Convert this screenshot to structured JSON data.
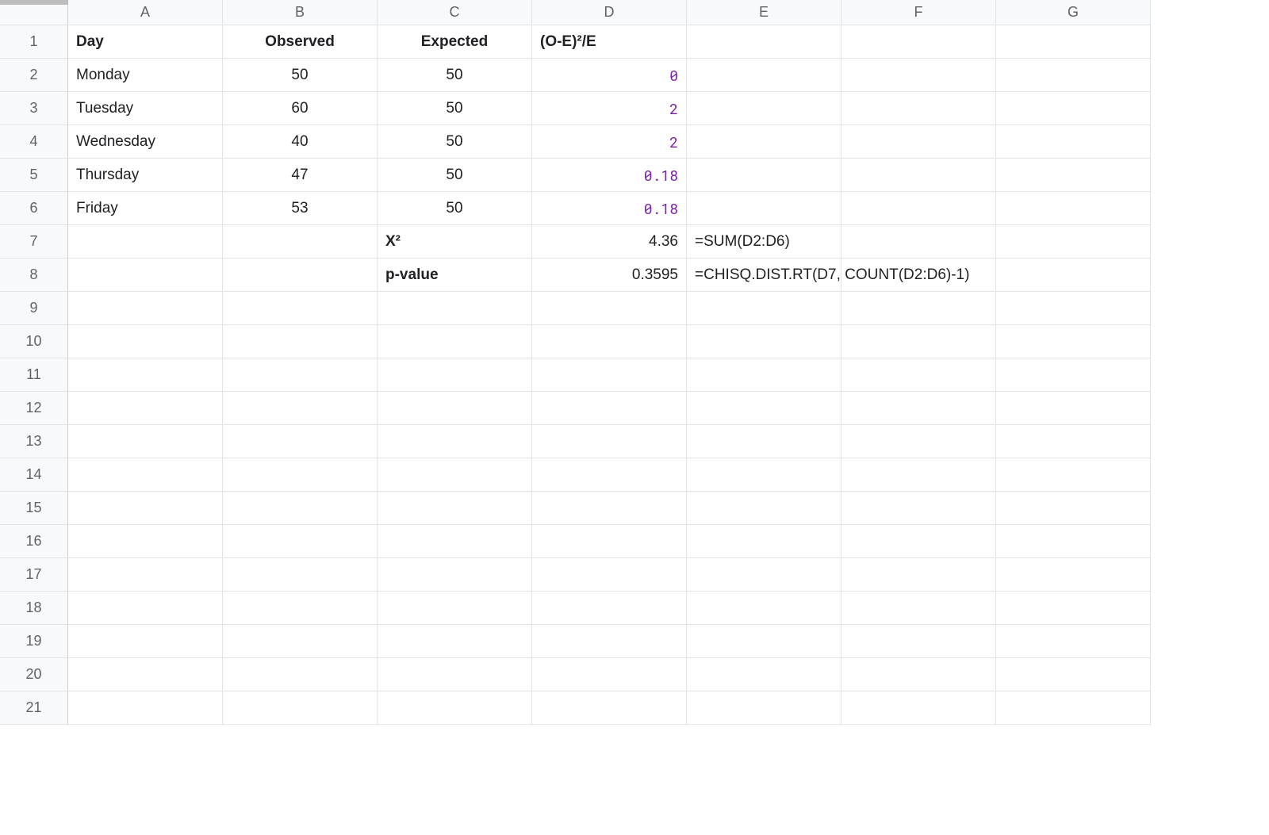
{
  "columns": [
    "A",
    "B",
    "C",
    "D",
    "E",
    "F",
    "G"
  ],
  "headers": {
    "day": "Day",
    "observed": "Observed",
    "expected": "Expected",
    "stat": "(O-E)²/E"
  },
  "rows": [
    {
      "day": "Monday",
      "observed": "50",
      "expected": "50",
      "stat": "0"
    },
    {
      "day": "Tuesday",
      "observed": "60",
      "expected": "50",
      "stat": "2"
    },
    {
      "day": "Wednesday",
      "observed": "40",
      "expected": "50",
      "stat": "2"
    },
    {
      "day": "Thursday",
      "observed": "47",
      "expected": "50",
      "stat": "0.18"
    },
    {
      "day": "Friday",
      "observed": "53",
      "expected": "50",
      "stat": "0.18"
    }
  ],
  "summary": {
    "x2_label": "X²",
    "x2_value": "4.36",
    "x2_formula": "=SUM(D2:D6)",
    "p_label": "p-value",
    "p_value": "0.3595",
    "p_formula": "=CHISQ.DIST.RT(D7, COUNT(D2:D6)-1)"
  },
  "visible_rows": 21
}
